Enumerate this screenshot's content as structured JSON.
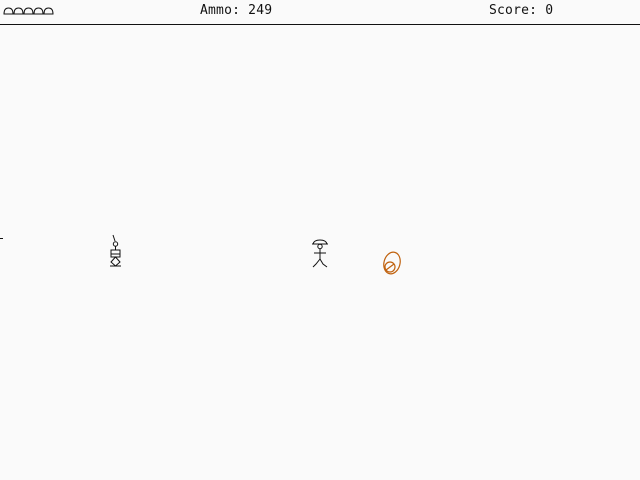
{
  "hud": {
    "lives_icon": "dome-life-icon",
    "lives_count": 5,
    "ammo_label": "Ammo:",
    "ammo_value": "249",
    "score_label": "Score:",
    "score_value": "0"
  },
  "entities": {
    "player_icon": "stick-figure-hat-icon",
    "enemy_icon": "robot-turret-icon",
    "pickup_icon": "orange-capsule-icon"
  },
  "colors": {
    "background": "#fafafa",
    "ink": "#111111",
    "pickup": "#c0620f"
  }
}
